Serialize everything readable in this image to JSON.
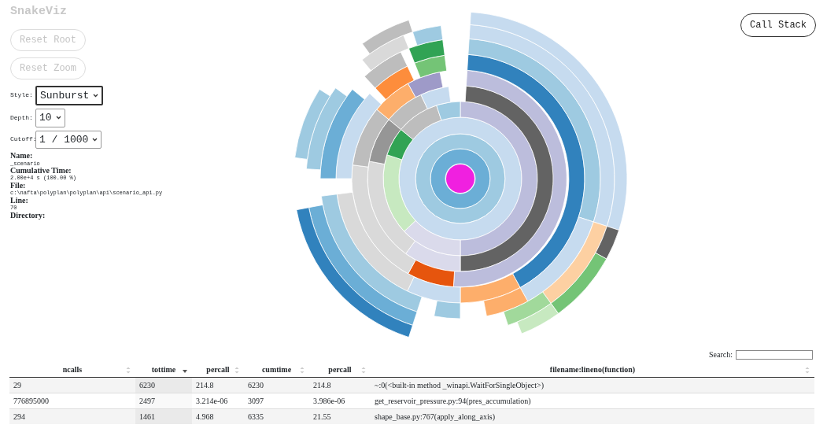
{
  "app": {
    "title": "SnakeViz"
  },
  "buttons": [
    {
      "label": "Reset Root",
      "disabled": true
    },
    {
      "label": "Reset Zoom",
      "disabled": true
    }
  ],
  "controls": [
    {
      "label": "Style:",
      "value": "Sunburst"
    },
    {
      "label": "Depth:",
      "value": "10"
    },
    {
      "label": "Cutoff:",
      "value": "1 / 1000"
    }
  ],
  "info": [
    {
      "label": "Name:",
      "value": "_scenario"
    },
    {
      "label": "Cumulative Time:",
      "value": "2.00e+4 s (100.00 %)"
    },
    {
      "label": "File:",
      "value": "c:\\nafta\\polyplan\\polyplan\\api\\scenario_api.py"
    },
    {
      "label": "Line:",
      "value": "70"
    },
    {
      "label": "Directory:"
    }
  ],
  "call_stack_button": {
    "label": "Call Stack"
  },
  "search": {
    "label": "Search:"
  },
  "table": {
    "columns": [
      {
        "label": "ncalls",
        "selected": false
      },
      {
        "label": "tottime",
        "selected": true
      },
      {
        "label": "percall",
        "selected": false
      },
      {
        "label": "cumtime",
        "selected": false
      },
      {
        "label": "percall",
        "selected": false
      },
      {
        "label": "filename:lineno(function)",
        "selected": false
      }
    ],
    "rows": [
      [
        "29",
        "6230",
        "214.8",
        "6230",
        "214.8",
        "~:0(<built-in method _winapi.WaitForSingleObject>)"
      ],
      [
        "776895000",
        "2497",
        "3.214e-06",
        "3097",
        "3.986e-06",
        "get_reservoir_pressure.py:94(pres_accumulation)"
      ],
      [
        "294",
        "1461",
        "4.968",
        "6335",
        "21.55",
        "shape_base.py:767(apply_along_axis)"
      ]
    ]
  }
}
